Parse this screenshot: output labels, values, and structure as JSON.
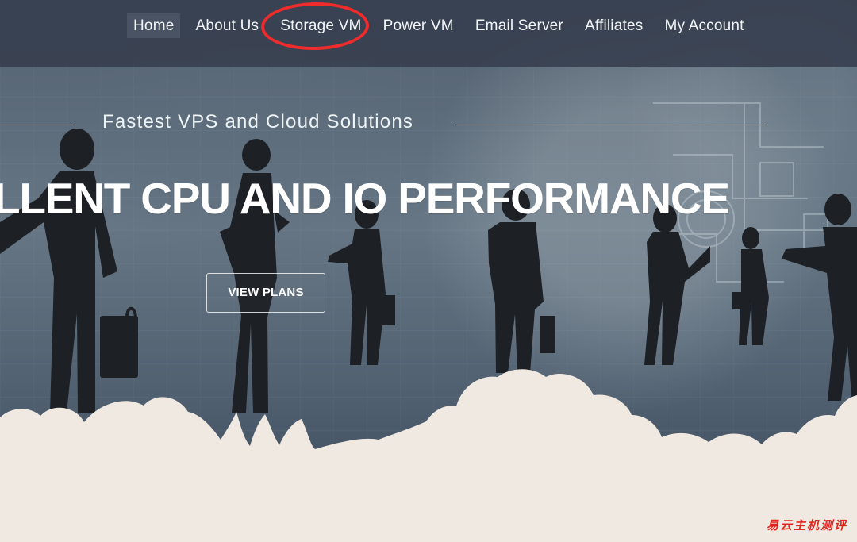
{
  "nav": {
    "items": [
      {
        "label": "Home"
      },
      {
        "label": "About Us"
      },
      {
        "label": "Storage VM"
      },
      {
        "label": "Power VM"
      },
      {
        "label": "Email Server"
      },
      {
        "label": "Affiliates"
      },
      {
        "label": "My Account"
      }
    ]
  },
  "hero": {
    "subtitle": "Fastest VPS and Cloud Solutions",
    "headline": "LLENT CPU AND IO PERFORMANCE",
    "cta": "VIEW PLANS"
  },
  "watermark": {
    "text": "易云主机测评"
  },
  "colors": {
    "nav_background": "#353d4d",
    "highlight_oval": "#ef2b2b",
    "cloud": "#efe9e2",
    "watermark": "#e0281f"
  }
}
